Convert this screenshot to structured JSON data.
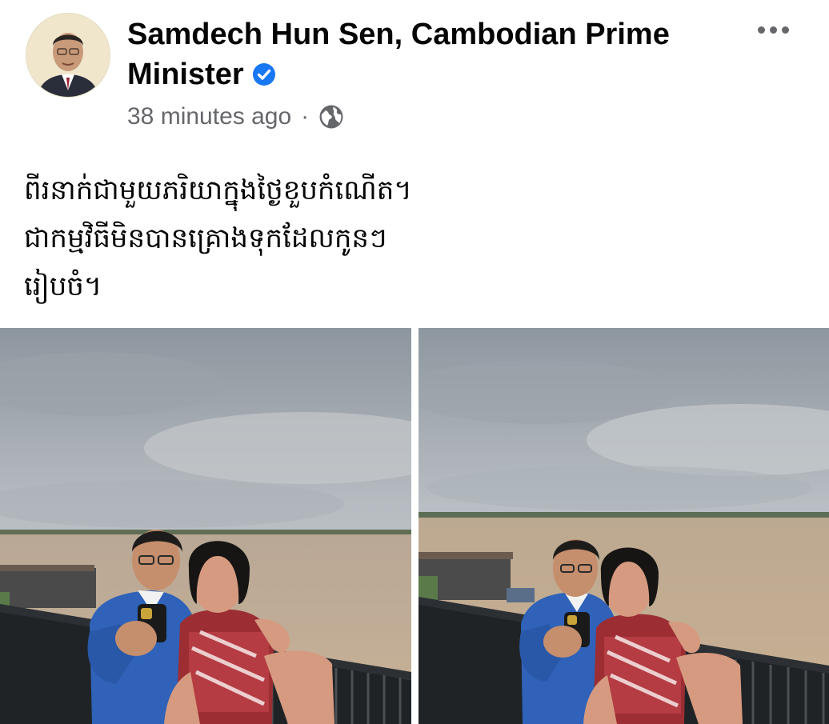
{
  "post": {
    "author": "Samdech Hun Sen, Cambodian Prime Minister",
    "author_verified": true,
    "time_ago": "38 minutes ago",
    "separator": "·",
    "privacy_icon": "globe-icon",
    "more_icon": "more-options-icon",
    "text_lines": [
      "ពីរនាក់ជាមួយភរិយាក្នុងថ្ងៃខួបកំណើត។",
      "ជាកម្មវិធីមិនបានគ្រោងទុកដែលកូនៗ",
      "រៀបចំ។"
    ]
  },
  "photos": [
    {
      "name": "photo-left"
    },
    {
      "name": "photo-right"
    }
  ],
  "colors": {
    "verified_badge": "#1877f2",
    "meta_text": "#65676b",
    "author_text": "#050505"
  }
}
